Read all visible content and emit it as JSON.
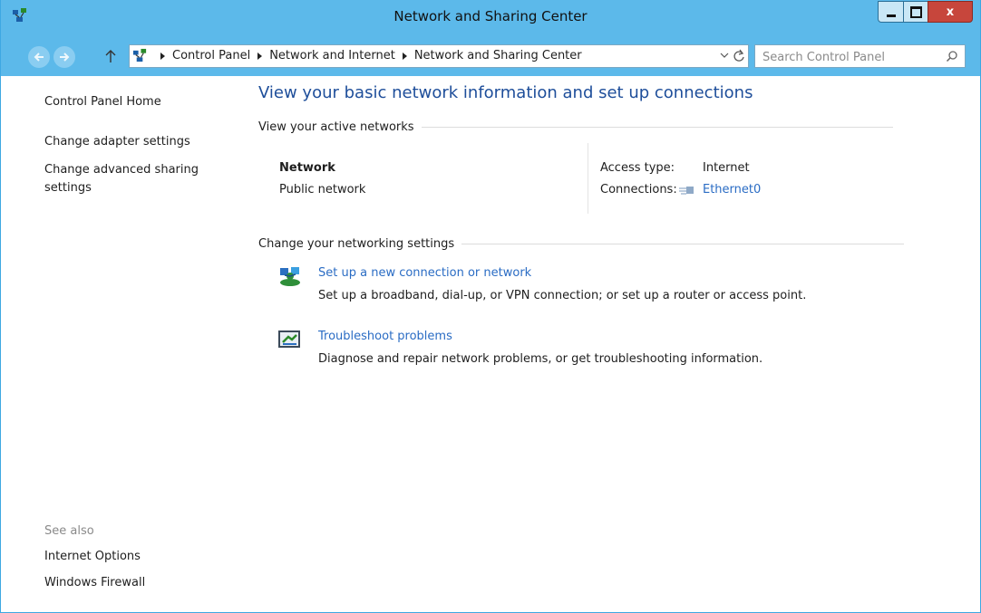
{
  "window": {
    "title": "Network and Sharing Center",
    "close_label": "x"
  },
  "address": {
    "crumbs": [
      "Control Panel",
      "Network and Internet",
      "Network and Sharing Center"
    ]
  },
  "search": {
    "placeholder": "Search Control Panel"
  },
  "sidebar": {
    "home": "Control Panel Home",
    "adapter": "Change adapter settings",
    "advanced": "Change advanced sharing settings",
    "see_also": "See also",
    "internet_options": "Internet Options",
    "firewall": "Windows Firewall"
  },
  "main": {
    "heading": "View your basic network information and set up connections",
    "active_section": "View your active networks",
    "network_name": "Network",
    "network_type": "Public network",
    "access_label": "Access type:",
    "access_value": "Internet",
    "connections_label": "Connections:",
    "connection_link": "Ethernet0",
    "change_section": "Change your networking settings",
    "tasks": [
      {
        "link": "Set up a new connection or network",
        "desc": "Set up a broadband, dial-up, or VPN connection; or set up a router or access point."
      },
      {
        "link": "Troubleshoot problems",
        "desc": "Diagnose and repair network problems, or get troubleshooting information."
      }
    ]
  },
  "colors": {
    "titlebar": "#5cb9ea",
    "link": "#2a6cc4",
    "heading": "#1e4e9a",
    "close_button": "#c7463c"
  },
  "icons": [
    "network-center-icon",
    "back-arrow-icon",
    "forward-arrow-icon",
    "up-arrow-icon",
    "chevron-down-icon",
    "refresh-icon",
    "search-icon",
    "ethernet-icon",
    "new-connection-icon",
    "troubleshoot-icon"
  ]
}
